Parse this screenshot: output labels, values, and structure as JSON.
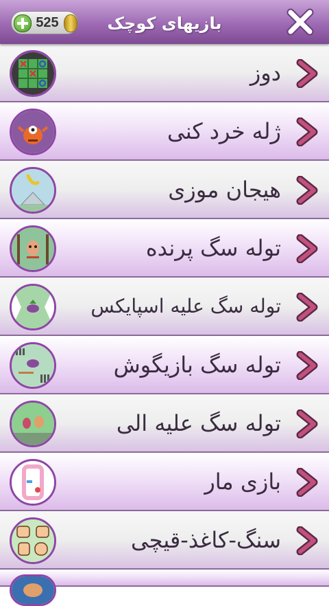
{
  "header": {
    "title": "بازیهای کوچک",
    "coins": "525",
    "close_icon": "close-x-icon"
  },
  "games": [
    {
      "label": "دوز",
      "thumb": "tic-tac-toe-icon"
    },
    {
      "label": "ژله خرد کنی",
      "thumb": "jelly-monster-icon"
    },
    {
      "label": "هیجان موزی",
      "thumb": "banana-icon"
    },
    {
      "label": "توله سگ پرنده",
      "thumb": "flying-puppy-icon"
    },
    {
      "label": "توله سگ علیه اسپایکس",
      "thumb": "puppy-vs-spikes-icon"
    },
    {
      "label": "توله سگ بازیگوش",
      "thumb": "playful-puppy-icon"
    },
    {
      "label": "توله سگ علیه الی",
      "thumb": "puppy-vs-ali-icon"
    },
    {
      "label": "بازی مار",
      "thumb": "snake-icon"
    },
    {
      "label": "سنگ-کاغذ-قیچی",
      "thumb": "rock-paper-scissors-icon"
    }
  ],
  "colors": {
    "header_purple": "#9d6ab3",
    "chevron_pink": "#c2507f",
    "thumb_border": "#8e46a6"
  }
}
